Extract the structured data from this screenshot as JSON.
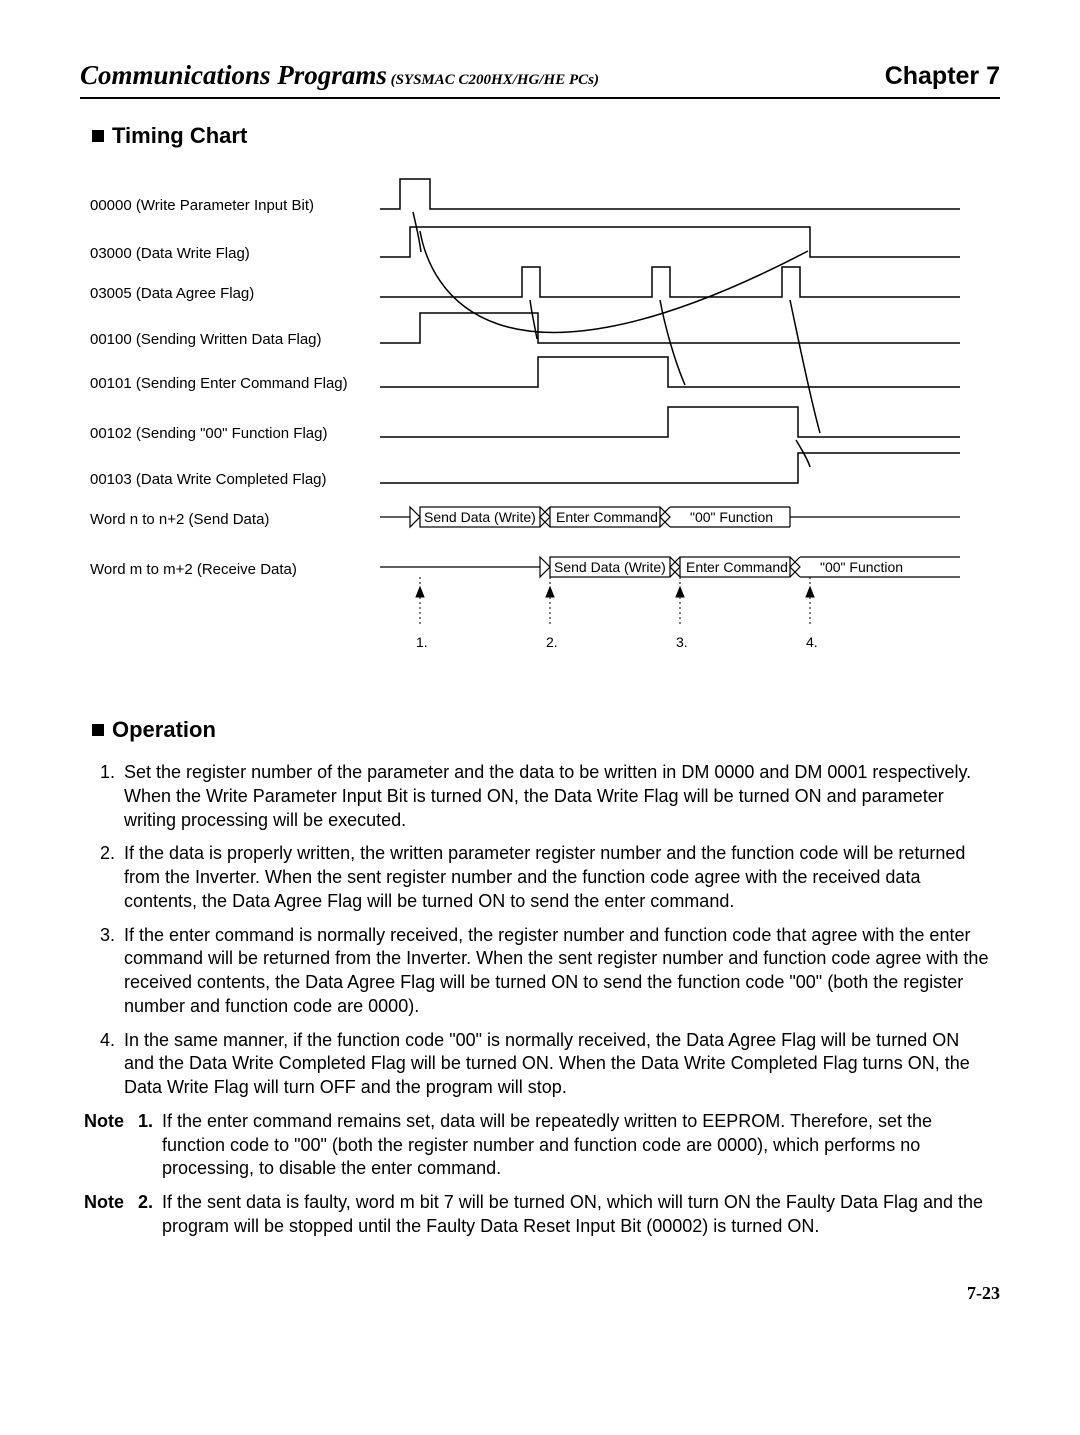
{
  "header": {
    "title_main": "Communications Programs",
    "title_sub": " (SYSMAC C200HX/HG/HE PCs)",
    "chapter": "Chapter 7"
  },
  "sections": {
    "timing_chart": "Timing Chart",
    "operation": "Operation"
  },
  "chart_data": {
    "type": "timing",
    "signals": [
      {
        "name": "00000 (Write Parameter Input Bit)"
      },
      {
        "name": "03000 (Data Write Flag)"
      },
      {
        "name": "03005 (Data Agree Flag)"
      },
      {
        "name": "00100 (Sending Written Data Flag)"
      },
      {
        "name": "00101 (Sending Enter Command Flag)"
      },
      {
        "name": "00102 (Sending \"00\" Function Flag)"
      },
      {
        "name": "00103 (Data Write Completed Flag)"
      },
      {
        "name": "Word n to n+2 (Send Data)"
      },
      {
        "name": "Word m to m+2 (Receive Data)"
      }
    ],
    "send_boxes": [
      "Send Data (Write)",
      "Enter Command",
      "\"00\" Function"
    ],
    "recv_boxes": [
      "Send Data (Write)",
      "Enter Command",
      "\"00\" Function"
    ],
    "markers": [
      "1.",
      "2.",
      "3.",
      "4."
    ]
  },
  "operation": {
    "items": [
      {
        "n": "1.",
        "t": "Set the register number of the parameter and the data to be written in DM 0000 and DM 0001 respectively. When the Write Parameter Input Bit is turned ON, the Data Write Flag will be turned ON and parameter writing processing will be executed."
      },
      {
        "n": "2.",
        "t": "If the data is properly written, the written parameter register number and the function code will be returned from the Inverter. When the sent register number and the function code agree with the received data contents, the Data Agree Flag will be turned ON to send the enter command."
      },
      {
        "n": "3.",
        "t": "If the enter command is normally received, the register number and function code that agree with the enter command will be returned from the Inverter. When the sent register number and function code agree with the received contents, the Data Agree Flag will be turned ON to send the function code \"00\" (both the register number and function code are 0000)."
      },
      {
        "n": "4.",
        "t": "In the same manner, if the function code \"00\" is normally received, the Data Agree Flag will be turned ON and the Data Write Completed Flag will be turned ON. When the Data Write Completed Flag turns ON, the Data Write Flag will turn OFF and the program will stop."
      }
    ],
    "notes": [
      {
        "n": "1.",
        "t": "If the enter command remains set, data will be repeatedly written to EEPROM. Therefore, set the function code to \"00\" (both the register number and function code are 0000), which performs no processing, to disable the enter command."
      },
      {
        "n": "2.",
        "t": "If the sent data is faulty, word m bit 7 will be turned ON, which will turn ON the Faulty Data Flag and the program will be stopped until the Faulty Data Reset Input Bit (00002) is turned ON."
      }
    ],
    "note_label": "Note"
  },
  "page_number": "7-23"
}
